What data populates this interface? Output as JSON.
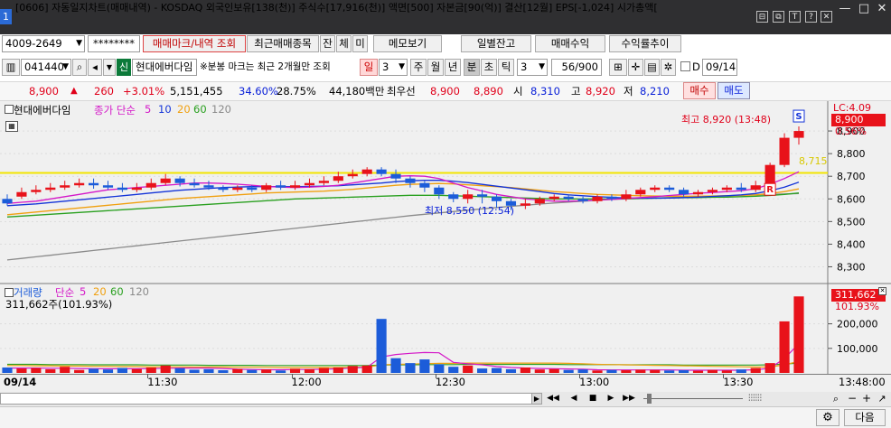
{
  "titlebar": {
    "window_number": "1",
    "title": "[0606] 자동일지차트(매매내역) - KOSDAQ 외국인보유[138(천)] 주식수[17,916(천)] 액면[500] 자본금[90(억)] 결산[12월] EPS[-1,024] 시가총액[",
    "icons": [
      "link-icon",
      "restore-window-icon",
      "text-size-icon",
      "help-icon",
      "close-small-icon"
    ],
    "window_buttons": [
      "minimize-icon",
      "maximize-icon",
      "close-icon"
    ],
    "button_glyphs": {
      "minimize": "—",
      "maximize": "□",
      "close": "✕",
      "link": "⊟",
      "restore": "⧉",
      "text": "T",
      "help": "?",
      "close_small": "✕"
    }
  },
  "toolbar1": {
    "account": "4009-2649",
    "password": "********",
    "tabs": [
      "매매마크/내역 조회",
      "최근매매종목",
      "잔",
      "체",
      "미"
    ],
    "memo_label": "메모보기",
    "buttons": [
      "일별잔고",
      "매매수익",
      "수익률추이"
    ]
  },
  "toolbar2": {
    "code": "041440",
    "credit_badge": "신",
    "stock_name": "현대에버다임",
    "notice": "※분봉 마크는 최근 2개월만 조회",
    "period_tabs": [
      "일",
      "주",
      "월",
      "년",
      "분",
      "초",
      "틱"
    ],
    "period_number": "3",
    "minute_value": "3",
    "count": "56/900",
    "date_checkbox_label": "D",
    "date": "09/14",
    "icons": [
      "chart-tool-icon",
      "crosshair-icon",
      "save-icon",
      "settings-icon"
    ]
  },
  "quote": {
    "price": "8,900",
    "arrow": "▲",
    "change": "260",
    "change_pct": "+3.01%",
    "volume": "5,151,455",
    "vol_ratio": "34.60%",
    "turnover_pct": "28.75%",
    "amount": "44,180백만",
    "best_label": "최우선",
    "best_ask": "8,900",
    "best_bid": "8,890",
    "open_label": "시",
    "open": "8,310",
    "high_label": "고",
    "high": "8,920",
    "low_label": "저",
    "low": "8,210",
    "buy_label": "매수",
    "sell_label": "매도"
  },
  "price_panel": {
    "stock_label": "현대에버다임",
    "ma_label": "종가 단순",
    "ma_periods": [
      "5",
      "10",
      "20",
      "60",
      "120"
    ],
    "lc_label": "LC:4.09",
    "current_price": "8,900",
    "current_pct": "0.56%",
    "line_price": "8,715",
    "high_annotation": "최고 8,920 (13:48)",
    "low_annotation": "최저 8,550 (12:54)",
    "mark_sell": "S",
    "mark_buy": "R"
  },
  "volume_panel": {
    "label": "거래량",
    "ma_label": "단순",
    "ma_periods": [
      "5",
      "20",
      "60",
      "120"
    ],
    "value_label": "311,662주(101.93%)",
    "current": "311,662",
    "current_pct": "101.93%",
    "axis_ticks": [
      "200,000",
      "100,000"
    ]
  },
  "time_axis": {
    "date": "09/14",
    "ticks": [
      "11:30",
      "12:00",
      "12:30",
      "13:00",
      "13:30"
    ],
    "last_time": "13:48:00"
  },
  "footer": {
    "next_label": "다음",
    "settings_icon": "gear-icon",
    "scroll_icons": [
      "rewind-icon",
      "prev-icon",
      "stop-icon",
      "next-icon",
      "forward-icon"
    ],
    "zoom_icons": [
      "chart-type-icon",
      "zoom-in-icon",
      "zoom-out-icon",
      "plus-icon"
    ]
  },
  "colors": {
    "up": "#e8121a",
    "down": "#1c5cd9",
    "ma5": "#d418c8",
    "ma10": "#1434d8",
    "ma20": "#f0a010",
    "ma60": "#2aa020",
    "ma120": "#8a8a8a",
    "highlight_line": "#f2e400",
    "panel_bg": "#f0f0f0"
  },
  "chart_data": [
    {
      "type": "candlestick",
      "interval": "3min",
      "ylim": [
        8250,
        9000
      ],
      "y_ticks": [
        8900,
        8800,
        8700,
        8600,
        8500,
        8400,
        8300
      ],
      "candles": [
        [
          8600,
          8580,
          8620,
          8570
        ],
        [
          8610,
          8630,
          8650,
          8600
        ],
        [
          8630,
          8640,
          8660,
          8620
        ],
        [
          8640,
          8650,
          8670,
          8630
        ],
        [
          8650,
          8660,
          8680,
          8640
        ],
        [
          8660,
          8670,
          8690,
          8650
        ],
        [
          8670,
          8660,
          8690,
          8645
        ],
        [
          8660,
          8650,
          8680,
          8640
        ],
        [
          8650,
          8640,
          8670,
          8630
        ],
        [
          8640,
          8650,
          8670,
          8630
        ],
        [
          8650,
          8670,
          8690,
          8640
        ],
        [
          8670,
          8690,
          8710,
          8660
        ],
        [
          8690,
          8670,
          8700,
          8655
        ],
        [
          8670,
          8660,
          8690,
          8650
        ],
        [
          8660,
          8650,
          8680,
          8640
        ],
        [
          8650,
          8640,
          8660,
          8630
        ],
        [
          8640,
          8650,
          8660,
          8630
        ],
        [
          8650,
          8640,
          8660,
          8630
        ],
        [
          8640,
          8660,
          8670,
          8630
        ],
        [
          8660,
          8650,
          8680,
          8640
        ],
        [
          8650,
          8660,
          8680,
          8640
        ],
        [
          8660,
          8670,
          8690,
          8650
        ],
        [
          8670,
          8680,
          8700,
          8660
        ],
        [
          8680,
          8700,
          8720,
          8670
        ],
        [
          8700,
          8710,
          8730,
          8690
        ],
        [
          8710,
          8730,
          8740,
          8700
        ],
        [
          8730,
          8710,
          8740,
          8700
        ],
        [
          8710,
          8690,
          8730,
          8670
        ],
        [
          8690,
          8670,
          8700,
          8650
        ],
        [
          8670,
          8650,
          8680,
          8630
        ],
        [
          8650,
          8620,
          8660,
          8600
        ],
        [
          8620,
          8600,
          8630,
          8585
        ],
        [
          8600,
          8620,
          8640,
          8580
        ],
        [
          8620,
          8610,
          8640,
          8580
        ],
        [
          8610,
          8590,
          8620,
          8560
        ],
        [
          8590,
          8570,
          8600,
          8550
        ],
        [
          8570,
          8580,
          8600,
          8555
        ],
        [
          8580,
          8600,
          8610,
          8570
        ],
        [
          8600,
          8610,
          8620,
          8590
        ],
        [
          8610,
          8600,
          8620,
          8590
        ],
        [
          8600,
          8590,
          8610,
          8580
        ],
        [
          8590,
          8610,
          8620,
          8580
        ],
        [
          8610,
          8600,
          8620,
          8590
        ],
        [
          8600,
          8620,
          8640,
          8590
        ],
        [
          8620,
          8640,
          8650,
          8610
        ],
        [
          8640,
          8650,
          8660,
          8630
        ],
        [
          8650,
          8640,
          8660,
          8630
        ],
        [
          8640,
          8620,
          8650,
          8610
        ],
        [
          8620,
          8630,
          8640,
          8610
        ],
        [
          8630,
          8640,
          8650,
          8620
        ],
        [
          8640,
          8650,
          8660,
          8630
        ],
        [
          8650,
          8640,
          8670,
          8630
        ],
        [
          8640,
          8660,
          8680,
          8630
        ],
        [
          8660,
          8750,
          8760,
          8650
        ],
        [
          8750,
          8870,
          8890,
          8740
        ],
        [
          8870,
          8900,
          8920,
          8840
        ]
      ],
      "ma5": [
        8580,
        8585,
        8590,
        8600,
        8610,
        8620,
        8630,
        8640,
        8645,
        8650,
        8655,
        8660,
        8665,
        8670,
        8670,
        8668,
        8665,
        8660,
        8655,
        8652,
        8650,
        8652,
        8655,
        8660,
        8670,
        8680,
        8690,
        8700,
        8702,
        8700,
        8690,
        8670,
        8650,
        8635,
        8620,
        8610,
        8600,
        8595,
        8590,
        8590,
        8592,
        8595,
        8598,
        8602,
        8606,
        8610,
        8615,
        8620,
        8625,
        8628,
        8632,
        8636,
        8645,
        8665,
        8690,
        8720
      ],
      "ma10": [
        8570,
        8574,
        8578,
        8584,
        8590,
        8596,
        8602,
        8608,
        8614,
        8620,
        8626,
        8632,
        8638,
        8642,
        8646,
        8650,
        8652,
        8654,
        8654,
        8654,
        8654,
        8655,
        8656,
        8658,
        8662,
        8666,
        8670,
        8676,
        8680,
        8682,
        8682,
        8678,
        8672,
        8664,
        8656,
        8648,
        8640,
        8632,
        8624,
        8618,
        8614,
        8610,
        8607,
        8604,
        8603,
        8603,
        8604,
        8606,
        8608,
        8611,
        8614,
        8618,
        8624,
        8636,
        8652,
        8674
      ],
      "ma20": [
        8530,
        8536,
        8542,
        8548,
        8554,
        8560,
        8566,
        8572,
        8578,
        8584,
        8590,
        8596,
        8602,
        8606,
        8610,
        8614,
        8618,
        8622,
        8626,
        8628,
        8630,
        8632,
        8634,
        8638,
        8642,
        8648,
        8654,
        8660,
        8664,
        8666,
        8668,
        8666,
        8662,
        8658,
        8654,
        8650,
        8644,
        8638,
        8632,
        8628,
        8624,
        8620,
        8618,
        8616,
        8614,
        8613,
        8612,
        8612,
        8612,
        8613,
        8614,
        8616,
        8618,
        8624,
        8632,
        8644
      ],
      "ma60": [
        8520,
        8524,
        8528,
        8532,
        8536,
        8540,
        8544,
        8548,
        8552,
        8556,
        8560,
        8564,
        8568,
        8572,
        8576,
        8580,
        8584,
        8588,
        8592,
        8596,
        8600,
        8602,
        8604,
        8606,
        8608,
        8610,
        8612,
        8614,
        8616,
        8616,
        8616,
        8614,
        8612,
        8610,
        8608,
        8606,
        8604,
        8602,
        8600,
        8600,
        8600,
        8600,
        8600,
        8601,
        8602,
        8603,
        8604,
        8605,
        8606,
        8607,
        8608,
        8610,
        8612,
        8615,
        8620,
        8626
      ],
      "ma120": [
        8330,
        8337,
        8344,
        8351,
        8358,
        8365,
        8372,
        8379,
        8386,
        8393,
        8400,
        8407,
        8414,
        8421,
        8428,
        8435,
        8442,
        8449,
        8456,
        8463,
        8470,
        8477,
        8484,
        8491,
        8498,
        8505,
        8512,
        8519,
        8526,
        8532,
        8538,
        8544,
        8550,
        8556,
        8562,
        8567,
        8572,
        8577,
        8582,
        8586,
        8590,
        8594,
        8598,
        8600,
        8602,
        8604,
        8606,
        8608,
        8610,
        8612,
        8614,
        8616,
        8618,
        8620,
        8622,
        8624
      ],
      "highlight_level": 8715
    },
    {
      "type": "bar",
      "ylim": [
        0,
        320000
      ],
      "y_ticks": [
        200000,
        100000
      ],
      "values": [
        22000,
        18000,
        20000,
        15000,
        25000,
        12000,
        17000,
        14000,
        20000,
        16000,
        22000,
        30000,
        19000,
        13000,
        15000,
        11000,
        16000,
        12000,
        14000,
        10000,
        17000,
        15000,
        20000,
        22000,
        28000,
        30000,
        220000,
        60000,
        40000,
        55000,
        35000,
        25000,
        30000,
        18000,
        20000,
        15000,
        22000,
        14000,
        16000,
        12000,
        14000,
        10000,
        12000,
        11000,
        13000,
        12000,
        10000,
        11000,
        9000,
        12000,
        10000,
        14000,
        20000,
        40000,
        210000,
        311662
      ],
      "ma5": [
        20000,
        20000,
        20000,
        19000,
        19000,
        18000,
        17000,
        17000,
        17000,
        17000,
        18000,
        19000,
        20000,
        20000,
        20000,
        18000,
        15000,
        14000,
        13000,
        13000,
        14000,
        14000,
        15000,
        17000,
        20000,
        23000,
        65000,
        75000,
        80000,
        83000,
        82000,
        43000,
        37000,
        33000,
        26000,
        22000,
        20000,
        18000,
        17000,
        16000,
        15000,
        13000,
        12000,
        12000,
        12000,
        12000,
        12000,
        11000,
        11000,
        11000,
        11000,
        11000,
        13000,
        19000,
        59000,
        119000
      ],
      "ma20": [
        30000,
        30000,
        29000,
        29000,
        28000,
        28000,
        27000,
        27000,
        26000,
        26000,
        25000,
        25000,
        25000,
        24000,
        24000,
        24000,
        23000,
        23000,
        23000,
        22000,
        22000,
        22000,
        22000,
        22000,
        23000,
        23000,
        33000,
        35000,
        36000,
        38000,
        39000,
        39000,
        40000,
        40000,
        40000,
        40000,
        40000,
        40000,
        40000,
        39000,
        37000,
        35000,
        34000,
        33000,
        32000,
        31000,
        30000,
        29000,
        28000,
        27000,
        26000,
        25000,
        24000,
        24000,
        33000,
        47000
      ],
      "ma60": [
        35000,
        35000,
        35000,
        34000,
        34000,
        34000,
        33000,
        33000,
        33000,
        33000,
        32000,
        32000,
        32000,
        32000,
        31000,
        31000,
        31000,
        31000,
        30000,
        30000,
        30000,
        30000,
        30000,
        30000,
        30000,
        30000,
        32000,
        33000,
        33000,
        34000,
        34000,
        34000,
        35000,
        35000,
        35000,
        35000,
        35000,
        35000,
        35000,
        34000,
        34000,
        34000,
        34000,
        33000,
        33000,
        33000,
        33000,
        32000,
        32000,
        32000,
        32000,
        32000,
        32000,
        33000,
        36000,
        40000
      ]
    }
  ]
}
